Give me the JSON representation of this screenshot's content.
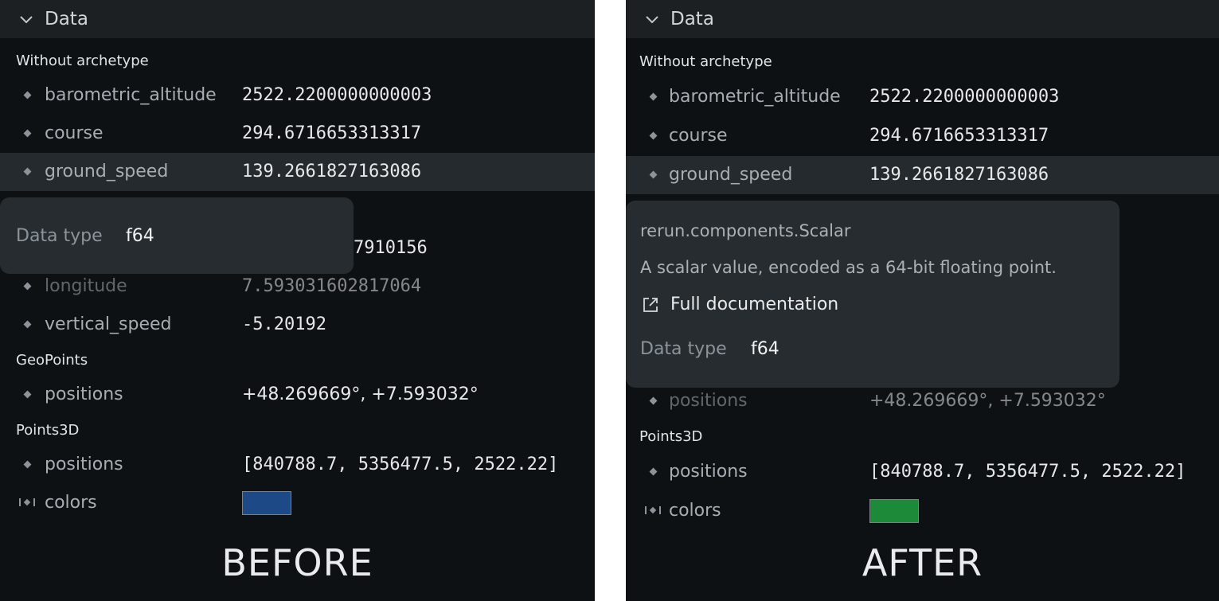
{
  "before": {
    "header_title": "Data",
    "section_without_archetype": "Without archetype",
    "rows_top": [
      {
        "name": "barometric_altitude",
        "value": "2522.2200000000003"
      },
      {
        "name": "course",
        "value": "294.6716653313317"
      },
      {
        "name": "ground_speed",
        "value": "139.2661827163086"
      }
    ],
    "partially_hidden_value": "7910156",
    "rows_mid": [
      {
        "name": "longitude",
        "value": "7.593031602817064"
      },
      {
        "name": "vertical_speed",
        "value": "-5.20192"
      }
    ],
    "section_geopoints": "GeoPoints",
    "geo_positions": {
      "name": "positions",
      "value": "+48.269669°, +7.593032°"
    },
    "section_points3d": "Points3D",
    "p3d_positions": {
      "name": "positions",
      "value": "[840788.7, 5356477.5, 2522.22]"
    },
    "colors": {
      "name": "colors",
      "swatch_color": "#1d4a87"
    },
    "tooltip": {
      "data_type_label": "Data type",
      "data_type_value": "f64"
    },
    "caption": "BEFORE"
  },
  "after": {
    "header_title": "Data",
    "section_without_archetype": "Without archetype",
    "rows_top": [
      {
        "name": "barometric_altitude",
        "value": "2522.2200000000003"
      },
      {
        "name": "course",
        "value": "294.6716653313317"
      },
      {
        "name": "ground_speed",
        "value": "139.2661827163086"
      }
    ],
    "geo_positions": {
      "name": "positions",
      "value": "+48.269669°, +7.593032°"
    },
    "section_points3d": "Points3D",
    "p3d_positions": {
      "name": "positions",
      "value": "[840788.7, 5356477.5, 2522.22]"
    },
    "colors": {
      "name": "colors",
      "swatch_color": "#1d8a3a"
    },
    "tooltip": {
      "component_name": "rerun.components.Scalar",
      "description": "A scalar value, encoded as a 64-bit floating point.",
      "link_text": "Full documentation",
      "data_type_label": "Data type",
      "data_type_value": "f64"
    },
    "caption": "AFTER"
  },
  "icons": {
    "collapse": "chevron-down-icon",
    "bullet": "diamond-bullet-icon",
    "batch": "batch-indicator-icon",
    "external_link": "external-link-icon"
  }
}
